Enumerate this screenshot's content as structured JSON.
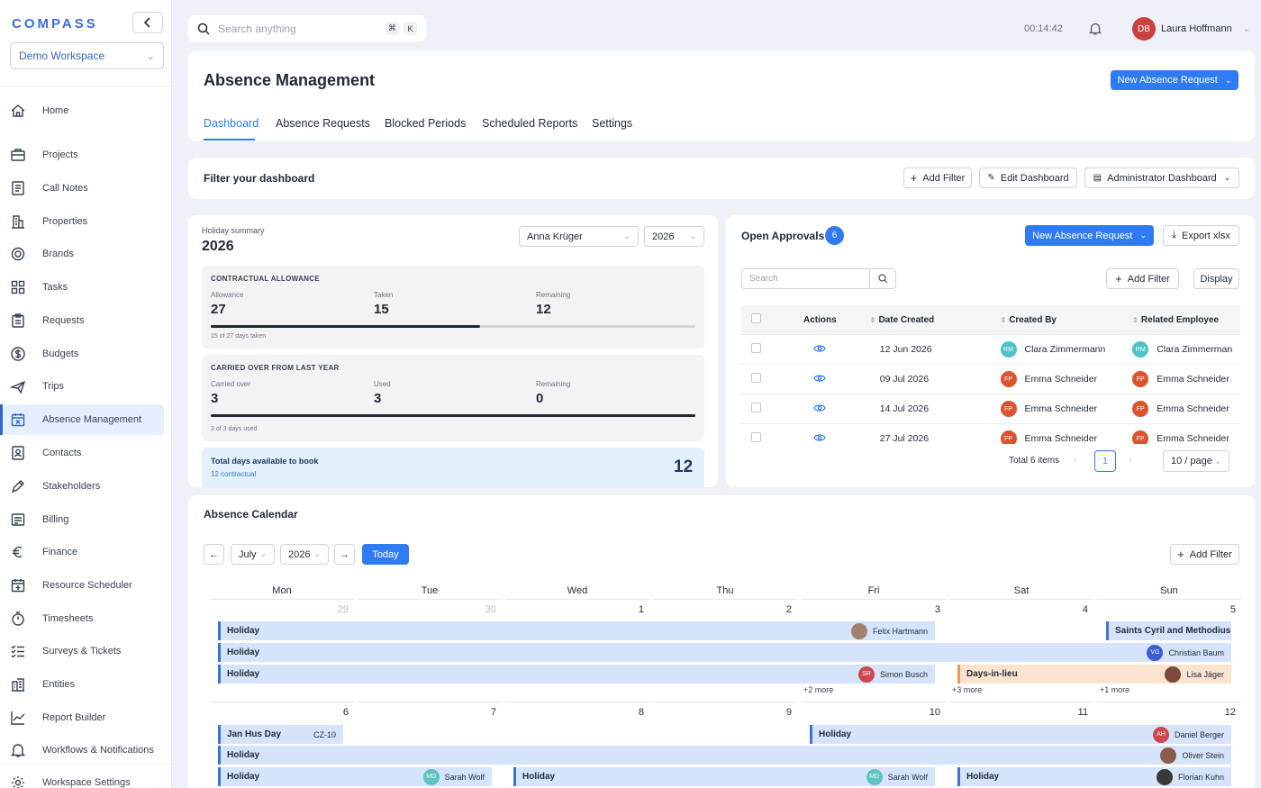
{
  "sidebar": {
    "logo": "COMPASS",
    "workspace": "Demo Workspace",
    "items": [
      {
        "label": "Home",
        "icon": "home-icon"
      },
      {
        "label": "Projects",
        "icon": "briefcase-icon"
      },
      {
        "label": "Call Notes",
        "icon": "notes-icon"
      },
      {
        "label": "Properties",
        "icon": "building-icon"
      },
      {
        "label": "Brands",
        "icon": "badge-icon"
      },
      {
        "label": "Tasks",
        "icon": "grid-icon"
      },
      {
        "label": "Requests",
        "icon": "clipboard-icon"
      },
      {
        "label": "Budgets",
        "icon": "dollar-icon"
      },
      {
        "label": "Trips",
        "icon": "plane-icon"
      },
      {
        "label": "Absence Management",
        "icon": "calendar-x-icon"
      },
      {
        "label": "Contacts",
        "icon": "contact-icon"
      },
      {
        "label": "Stakeholders",
        "icon": "pen-icon"
      },
      {
        "label": "Billing",
        "icon": "billing-icon"
      },
      {
        "label": "Finance",
        "icon": "euro-icon"
      },
      {
        "label": "Resource Scheduler",
        "icon": "calendar-plus-icon"
      },
      {
        "label": "Timesheets",
        "icon": "stopwatch-icon"
      },
      {
        "label": "Surveys & Tickets",
        "icon": "list-check-icon"
      },
      {
        "label": "Entities",
        "icon": "entities-icon"
      },
      {
        "label": "Report Builder",
        "icon": "chart-line-icon"
      },
      {
        "label": "Workflows & Notifications",
        "icon": "bell-icon"
      },
      {
        "label": "Workspace Settings",
        "icon": "gear-icon"
      }
    ]
  },
  "topbar": {
    "search_placeholder": "Search anything",
    "kbd1": "⌘",
    "kbd2": "K",
    "timer": "00:14:42",
    "user_initials": "DB",
    "user_name": "Laura Hoffmann"
  },
  "header": {
    "title": "Absence Management",
    "new_request": "New Absence Request",
    "tabs": [
      "Dashboard",
      "Absence Requests",
      "Blocked Periods",
      "Scheduled Reports",
      "Settings"
    ]
  },
  "filter": {
    "title": "Filter your dashboard",
    "add_filter": "Add Filter",
    "edit_dashboard": "Edit Dashboard",
    "admin_dashboard": "Administrator Dashboard"
  },
  "holiday": {
    "caption": "Holiday summary",
    "year": "2026",
    "employee": "Anna Krüger",
    "year_select": "2026",
    "contractual": {
      "title": "CONTRACTUAL ALLOWANCE",
      "l1": "Allowance",
      "v1": "27",
      "l2": "Taken",
      "v2": "15",
      "l3": "Remaining",
      "v3": "12",
      "progress": 0.5556,
      "note": "15 of 27 days taken"
    },
    "carried": {
      "title": "CARRIED OVER FROM LAST YEAR",
      "l1": "Carried over",
      "v1": "3",
      "l2": "Used",
      "v2": "3",
      "l3": "Remaining",
      "v3": "0",
      "progress": 1.0,
      "note": "3 of 3 days used"
    },
    "total": {
      "label": "Total days available to book",
      "sub": "12 contractual",
      "value": "12"
    }
  },
  "approvals": {
    "title": "Open Approvals",
    "count": "6",
    "new_request": "New Absence Request",
    "export": "Export xlsx",
    "search_placeholder": "Search",
    "add_filter": "Add Filter",
    "display": "Display",
    "columns": [
      "Actions",
      "Date Created",
      "Created By",
      "Related Employee"
    ],
    "rows": [
      {
        "date": "12 Jun 2026",
        "by_init": "RM",
        "by": "Clara Zimmermann",
        "by_color": "#4fc1c8",
        "rel_init": "RM",
        "rel": "Clara Zimmerman",
        "rel_color": "#4fc1c8"
      },
      {
        "date": "09 Jul 2026",
        "by_init": "FP",
        "by": "Emma Schneider",
        "by_color": "#d9542f",
        "rel_init": "FP",
        "rel": "Emma Schneider",
        "rel_color": "#d9542f"
      },
      {
        "date": "14 Jul 2026",
        "by_init": "FP",
        "by": "Emma Schneider",
        "by_color": "#d9542f",
        "rel_init": "FP",
        "rel": "Emma Schneider",
        "rel_color": "#d9542f"
      },
      {
        "date": "27 Jul 2026",
        "by_init": "FP",
        "by": "Emma Schneider",
        "by_color": "#d9542f",
        "rel_init": "FP",
        "rel": "Emma Schneider",
        "rel_color": "#d9542f"
      }
    ],
    "total": "Total 6 items",
    "page": "1",
    "per_page": "10 / page"
  },
  "calendar": {
    "title": "Absence Calendar",
    "month": "July",
    "year": "2026",
    "today": "Today",
    "add_filter": "Add Filter",
    "days": [
      "Mon",
      "Tue",
      "Wed",
      "Thu",
      "Fri",
      "Sat",
      "Sun"
    ],
    "week1": [
      "29",
      "30",
      "1",
      "2",
      "3",
      "4",
      "5"
    ],
    "week2": [
      "6",
      "7",
      "8",
      "9",
      "10",
      "11",
      "12"
    ],
    "events": {
      "e1": "Holiday",
      "e1_who": "Felix Hartmann",
      "e2": "Saints Cyril and Methodius Day",
      "e3": "Holiday",
      "e3_who": "Christian Baum",
      "e3_init": "VG",
      "e4": "Holiday",
      "e4_who": "Simon Busch",
      "e4_init": "SR",
      "e5": "Days-in-lieu",
      "e5_who": "Lisa Jäger",
      "m1": "+2 more",
      "m2": "+3 more",
      "m3": "+1 more",
      "f1": "Jan Hus Day",
      "f1_tag": "CZ-10",
      "f2": "Holiday",
      "f2_who": "Daniel Berger",
      "f2_init": "AH",
      "f3": "Holiday",
      "f3_who": "Oliver Stein",
      "f4": "Holiday",
      "f4_who": "Sarah Wolf",
      "f4_init": "MD",
      "f5": "Holiday",
      "f5_who": "Sarah Wolf",
      "f5_init": "MD",
      "f6": "Holiday",
      "f6_who": "Florian Kuhn"
    }
  },
  "colors": {
    "accent": "#2f7bf2",
    "active_nav": "#e6efff",
    "event": "#d6e4fb",
    "event_orange": "#fce3cf"
  }
}
